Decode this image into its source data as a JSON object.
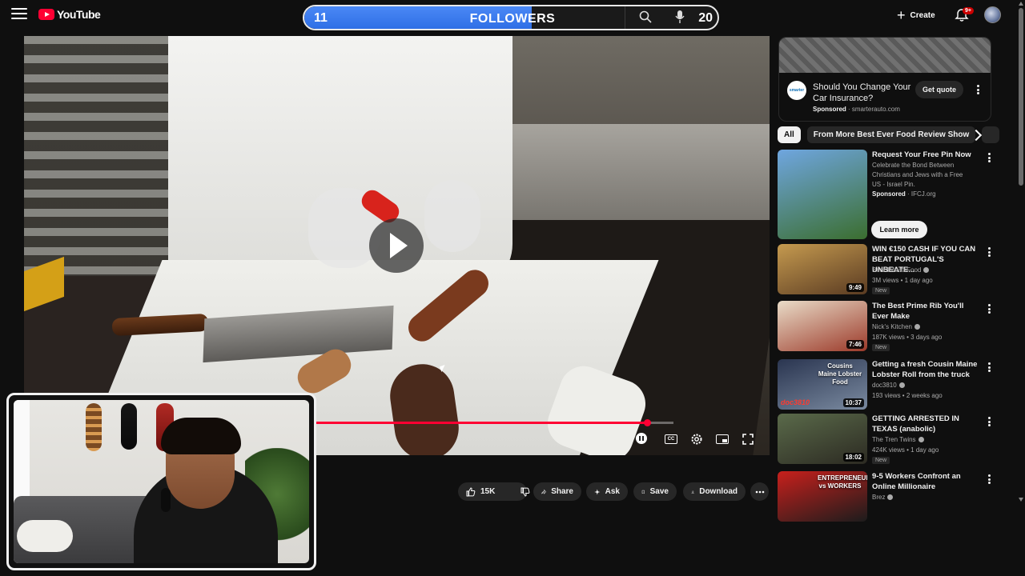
{
  "brand": {
    "logo_text": "YouTube",
    "accent": "#ff0033"
  },
  "followers_overlay": {
    "current": "11",
    "label": "FOLLOWERS",
    "goal": "20",
    "progress": 0.55,
    "fill_color": "#2f6fe6"
  },
  "header": {
    "create_label": "Create",
    "notifications_badge": "9+"
  },
  "video": {
    "progress_fraction": 0.925,
    "cc_label": "CC"
  },
  "actions": {
    "like_count": "15K",
    "share_label": "Share",
    "ask_label": "Ask",
    "save_label": "Save",
    "download_label": "Download"
  },
  "ad": {
    "logo_text": "smarter",
    "title": "Should You Change Your Car Insurance?",
    "sponsored": "Sponsored",
    "domain": "smarterauto.com",
    "cta": "Get quote"
  },
  "chips": [
    "All",
    "From More Best Ever Food Review Show"
  ],
  "recommendations": [
    {
      "title": "Request Your Free Pin Now",
      "description": "Celebrate the Bond Between Christians and Jews with a Free US - Israel Pin.",
      "sponsored": "Sponsored",
      "domain": "IFCJ.org",
      "cta": "Learn more",
      "thumb_colors": [
        "#6fa6e0",
        "#3b6e2f"
      ]
    },
    {
      "title": "WIN €150 CASH IF YOU CAN BEAT PORTUGAL'S UNBEATE...",
      "channel": "BeardMeatsFood",
      "stats": "3M views • 1 day ago",
      "badge": "New",
      "duration": "9:49",
      "thumb_colors": [
        "#c59a4f",
        "#5a3b22"
      ]
    },
    {
      "title": "The Best Prime Rib You'll Ever Make",
      "channel": "Nick's Kitchen",
      "stats": "187K views • 3 days ago",
      "badge": "New",
      "duration": "7:46",
      "thumb_colors": [
        "#e9dcc8",
        "#9c3a2a"
      ]
    },
    {
      "title": "Getting a fresh Cousin Maine Lobster Roll from the truck",
      "channel": "doc3810",
      "stats": "193 views • 2 weeks ago",
      "duration": "10:37",
      "thumb_text": "Cousins Maine Lobster Food",
      "thumb_tag": "doc3810",
      "thumb_colors": [
        "#2a3550",
        "#7a8aa0"
      ]
    },
    {
      "title": "GETTING ARRESTED IN TEXAS (anabolic)",
      "channel": "The Tren Twins",
      "stats": "424K views • 1 day ago",
      "badge": "New",
      "duration": "18:02",
      "thumb_colors": [
        "#5a6a4a",
        "#2c2a22"
      ]
    },
    {
      "title": "9-5 Workers Confront an Online Millionaire",
      "channel": "Brez",
      "thumb_text": "ENTREPRENEUR vs WORKERS",
      "thumb_colors": [
        "#c8201c",
        "#1c1c1c"
      ]
    }
  ]
}
